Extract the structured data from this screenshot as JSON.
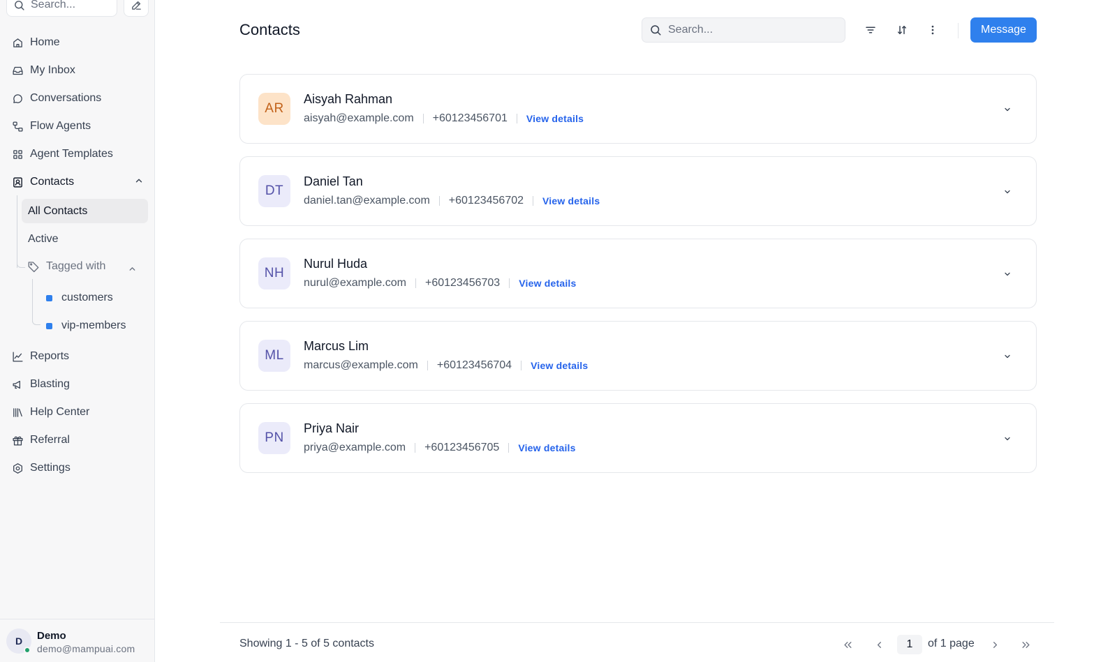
{
  "sidebar": {
    "search_placeholder": "Search...",
    "nav": [
      {
        "label": "Home",
        "icon": "home-icon"
      },
      {
        "label": "My Inbox",
        "icon": "inbox-icon"
      },
      {
        "label": "Conversations",
        "icon": "chat-bubble-icon"
      },
      {
        "label": "Flow Agents",
        "icon": "flow-icon"
      },
      {
        "label": "Agent Templates",
        "icon": "grid-icon"
      },
      {
        "label": "Contacts",
        "icon": "contact-card-icon"
      }
    ],
    "contacts_sub": {
      "all": "All Contacts",
      "active": "Active",
      "tagged_with": "Tagged with"
    },
    "tags": [
      "customers",
      "vip-members"
    ],
    "nav_bottom": [
      {
        "label": "Reports",
        "icon": "chart-line-icon"
      },
      {
        "label": "Blasting",
        "icon": "megaphone-icon"
      },
      {
        "label": "Help Center",
        "icon": "library-icon"
      },
      {
        "label": "Referral",
        "icon": "gift-icon"
      },
      {
        "label": "Settings",
        "icon": "gear-icon"
      }
    ],
    "user": {
      "initial": "D",
      "name": "Demo",
      "email": "demo@mampuai.com"
    }
  },
  "main": {
    "title": "Contacts",
    "search_placeholder": "Search...",
    "message_label": "Message",
    "view_details_label": "View details",
    "contacts": [
      {
        "initials": "AR",
        "name": "Aisyah Rahman",
        "email": "aisyah@example.com",
        "phone": "+60123456701"
      },
      {
        "initials": "DT",
        "name": "Daniel Tan",
        "email": "daniel.tan@example.com",
        "phone": "+60123456702"
      },
      {
        "initials": "NH",
        "name": "Nurul Huda",
        "email": "nurul@example.com",
        "phone": "+60123456703"
      },
      {
        "initials": "ML",
        "name": "Marcus Lim",
        "email": "marcus@example.com",
        "phone": "+60123456704"
      },
      {
        "initials": "PN",
        "name": "Priya Nair",
        "email": "priya@example.com",
        "phone": "+60123456705"
      }
    ],
    "footer": {
      "showing": "Showing 1 - 5 of 5 contacts",
      "page": "1",
      "of_pages": "of 1 page"
    }
  },
  "colors": {
    "accent": "#2f80ed",
    "avatar_orange_bg": "#fde3c8",
    "avatar_orange_fg": "#c2621a",
    "avatar_indigo_bg": "#ebebfa",
    "avatar_indigo_fg": "#5452a8"
  }
}
